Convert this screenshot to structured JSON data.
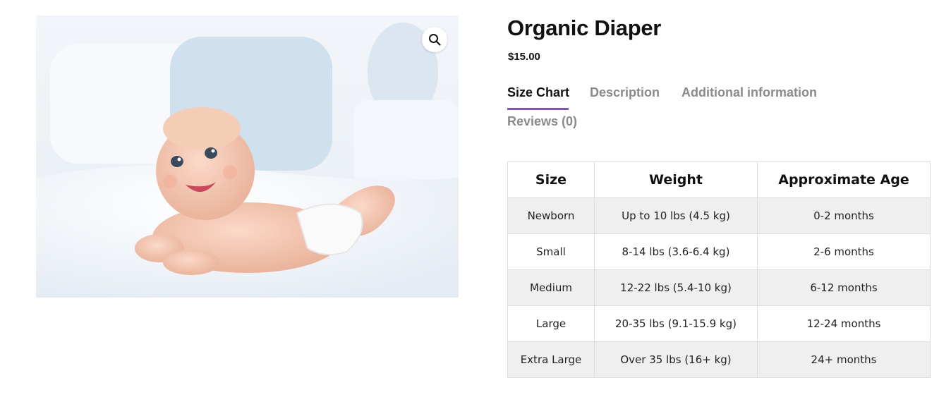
{
  "product": {
    "title": "Organic Diaper",
    "price": "$15.00",
    "image_alt": "baby lying on tummy on white bed",
    "zoom_icon": "magnifier-icon"
  },
  "tabs": [
    {
      "label": "Size Chart",
      "active": true
    },
    {
      "label": "Description",
      "active": false
    },
    {
      "label": "Additional information",
      "active": false
    },
    {
      "label": "Reviews (0)",
      "active": false
    }
  ],
  "size_chart": {
    "headers": [
      "Size",
      "Weight",
      "Approximate Age"
    ],
    "rows": [
      [
        "Newborn",
        "Up to 10 lbs (4.5 kg)",
        "0-2 months"
      ],
      [
        "Small",
        "8-14 lbs (3.6-6.4 kg)",
        "2-6 months"
      ],
      [
        "Medium",
        "12-22 lbs (5.4-10 kg)",
        "6-12 months"
      ],
      [
        "Large",
        "20-35 lbs (9.1-15.9 kg)",
        "12-24 months"
      ],
      [
        "Extra Large",
        "Over 35 lbs (16+ kg)",
        "24+ months"
      ]
    ]
  },
  "colors": {
    "tab_accent": "#7f54b3",
    "inactive_tab": "#8a8a8a",
    "striped_row": "#efefef"
  }
}
